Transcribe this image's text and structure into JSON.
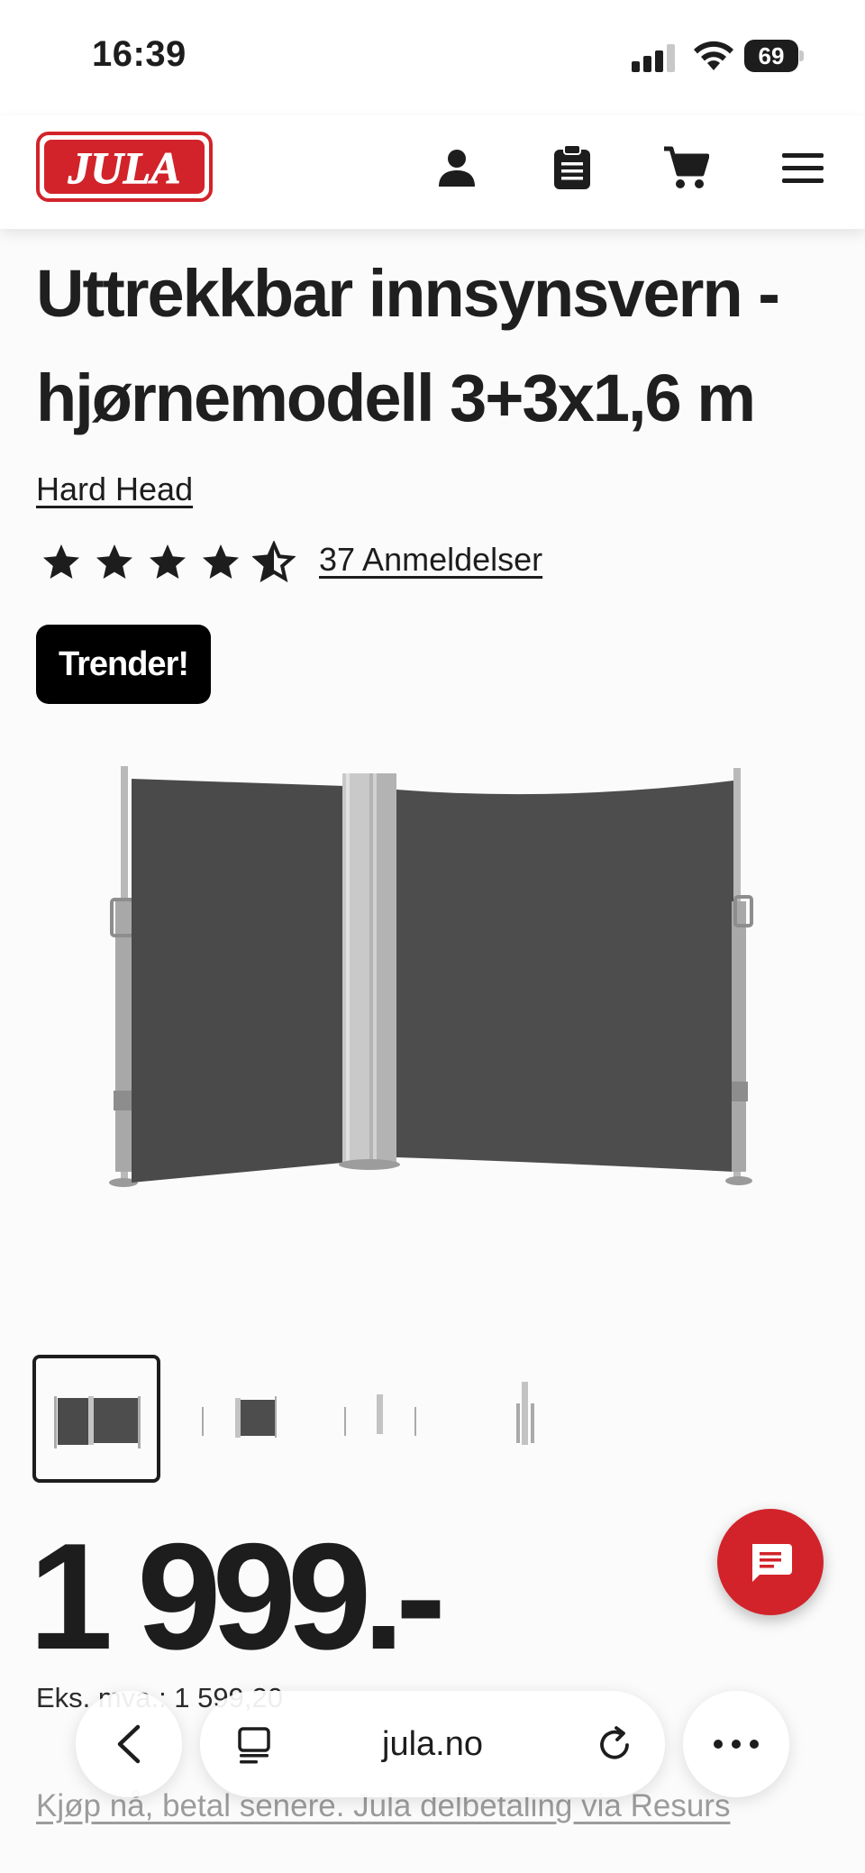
{
  "status_bar": {
    "time": "16:39",
    "battery_level": "69"
  },
  "header": {
    "logo_text": "JULA",
    "icons": [
      "account-icon",
      "clipboard-icon",
      "cart-icon",
      "menu-icon"
    ]
  },
  "product": {
    "title": "Uttrekkbar innsynsvern - hjørnemodell 3+3x1,6 m",
    "brand": "Hard Head",
    "rating": 4.5,
    "rating_max": 5,
    "reviews_label": "37 Anmeldelser",
    "badge": "Trender!",
    "thumbnail_count": 4,
    "active_thumbnail": 1,
    "price": "1 999.-",
    "eks_mva": "Eks. mva.: 1 599,20",
    "financing_link": "Kjøp nå, betal senere. Jula delbetaling via Resurs"
  },
  "browser": {
    "url": "jula.no"
  },
  "colors": {
    "brand_red": "#d2232a",
    "badge_bg": "#000000",
    "text": "#1d1d1d"
  }
}
